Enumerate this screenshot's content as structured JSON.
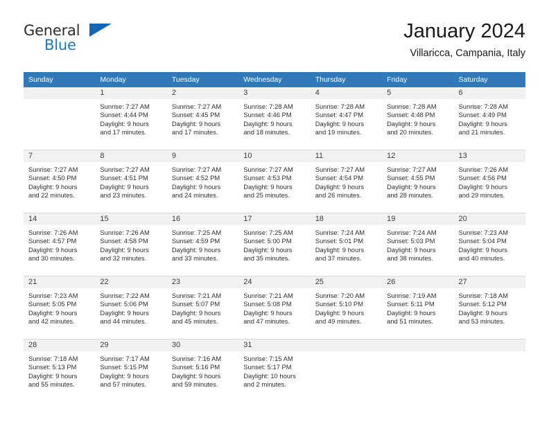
{
  "logo": {
    "word_top": "General",
    "word_bottom": "Blue",
    "triangle_color": "#1268b3",
    "blue_color": "#1a7ac4"
  },
  "header": {
    "title": "January 2024",
    "subtitle": "Villaricca, Campania, Italy"
  },
  "theme": {
    "header_row_bg": "#3179b9",
    "day_band_bg": "#f1f1f1",
    "grid_line": "#d9d9d9",
    "text": "#2e2e2e"
  },
  "weekday_headers": [
    "Sunday",
    "Monday",
    "Tuesday",
    "Wednesday",
    "Thursday",
    "Friday",
    "Saturday"
  ],
  "weeks": [
    [
      {
        "day": "",
        "sunrise": "",
        "sunset": "",
        "daylight1": "",
        "daylight2": ""
      },
      {
        "day": "1",
        "sunrise": "Sunrise: 7:27 AM",
        "sunset": "Sunset: 4:44 PM",
        "daylight1": "Daylight: 9 hours",
        "daylight2": "and 17 minutes."
      },
      {
        "day": "2",
        "sunrise": "Sunrise: 7:27 AM",
        "sunset": "Sunset: 4:45 PM",
        "daylight1": "Daylight: 9 hours",
        "daylight2": "and 17 minutes."
      },
      {
        "day": "3",
        "sunrise": "Sunrise: 7:28 AM",
        "sunset": "Sunset: 4:46 PM",
        "daylight1": "Daylight: 9 hours",
        "daylight2": "and 18 minutes."
      },
      {
        "day": "4",
        "sunrise": "Sunrise: 7:28 AM",
        "sunset": "Sunset: 4:47 PM",
        "daylight1": "Daylight: 9 hours",
        "daylight2": "and 19 minutes."
      },
      {
        "day": "5",
        "sunrise": "Sunrise: 7:28 AM",
        "sunset": "Sunset: 4:48 PM",
        "daylight1": "Daylight: 9 hours",
        "daylight2": "and 20 minutes."
      },
      {
        "day": "6",
        "sunrise": "Sunrise: 7:28 AM",
        "sunset": "Sunset: 4:49 PM",
        "daylight1": "Daylight: 9 hours",
        "daylight2": "and 21 minutes."
      }
    ],
    [
      {
        "day": "7",
        "sunrise": "Sunrise: 7:27 AM",
        "sunset": "Sunset: 4:50 PM",
        "daylight1": "Daylight: 9 hours",
        "daylight2": "and 22 minutes."
      },
      {
        "day": "8",
        "sunrise": "Sunrise: 7:27 AM",
        "sunset": "Sunset: 4:51 PM",
        "daylight1": "Daylight: 9 hours",
        "daylight2": "and 23 minutes."
      },
      {
        "day": "9",
        "sunrise": "Sunrise: 7:27 AM",
        "sunset": "Sunset: 4:52 PM",
        "daylight1": "Daylight: 9 hours",
        "daylight2": "and 24 minutes."
      },
      {
        "day": "10",
        "sunrise": "Sunrise: 7:27 AM",
        "sunset": "Sunset: 4:53 PM",
        "daylight1": "Daylight: 9 hours",
        "daylight2": "and 25 minutes."
      },
      {
        "day": "11",
        "sunrise": "Sunrise: 7:27 AM",
        "sunset": "Sunset: 4:54 PM",
        "daylight1": "Daylight: 9 hours",
        "daylight2": "and 26 minutes."
      },
      {
        "day": "12",
        "sunrise": "Sunrise: 7:27 AM",
        "sunset": "Sunset: 4:55 PM",
        "daylight1": "Daylight: 9 hours",
        "daylight2": "and 28 minutes."
      },
      {
        "day": "13",
        "sunrise": "Sunrise: 7:26 AM",
        "sunset": "Sunset: 4:56 PM",
        "daylight1": "Daylight: 9 hours",
        "daylight2": "and 29 minutes."
      }
    ],
    [
      {
        "day": "14",
        "sunrise": "Sunrise: 7:26 AM",
        "sunset": "Sunset: 4:57 PM",
        "daylight1": "Daylight: 9 hours",
        "daylight2": "and 30 minutes."
      },
      {
        "day": "15",
        "sunrise": "Sunrise: 7:26 AM",
        "sunset": "Sunset: 4:58 PM",
        "daylight1": "Daylight: 9 hours",
        "daylight2": "and 32 minutes."
      },
      {
        "day": "16",
        "sunrise": "Sunrise: 7:25 AM",
        "sunset": "Sunset: 4:59 PM",
        "daylight1": "Daylight: 9 hours",
        "daylight2": "and 33 minutes."
      },
      {
        "day": "17",
        "sunrise": "Sunrise: 7:25 AM",
        "sunset": "Sunset: 5:00 PM",
        "daylight1": "Daylight: 9 hours",
        "daylight2": "and 35 minutes."
      },
      {
        "day": "18",
        "sunrise": "Sunrise: 7:24 AM",
        "sunset": "Sunset: 5:01 PM",
        "daylight1": "Daylight: 9 hours",
        "daylight2": "and 37 minutes."
      },
      {
        "day": "19",
        "sunrise": "Sunrise: 7:24 AM",
        "sunset": "Sunset: 5:03 PM",
        "daylight1": "Daylight: 9 hours",
        "daylight2": "and 38 minutes."
      },
      {
        "day": "20",
        "sunrise": "Sunrise: 7:23 AM",
        "sunset": "Sunset: 5:04 PM",
        "daylight1": "Daylight: 9 hours",
        "daylight2": "and 40 minutes."
      }
    ],
    [
      {
        "day": "21",
        "sunrise": "Sunrise: 7:23 AM",
        "sunset": "Sunset: 5:05 PM",
        "daylight1": "Daylight: 9 hours",
        "daylight2": "and 42 minutes."
      },
      {
        "day": "22",
        "sunrise": "Sunrise: 7:22 AM",
        "sunset": "Sunset: 5:06 PM",
        "daylight1": "Daylight: 9 hours",
        "daylight2": "and 44 minutes."
      },
      {
        "day": "23",
        "sunrise": "Sunrise: 7:21 AM",
        "sunset": "Sunset: 5:07 PM",
        "daylight1": "Daylight: 9 hours",
        "daylight2": "and 45 minutes."
      },
      {
        "day": "24",
        "sunrise": "Sunrise: 7:21 AM",
        "sunset": "Sunset: 5:08 PM",
        "daylight1": "Daylight: 9 hours",
        "daylight2": "and 47 minutes."
      },
      {
        "day": "25",
        "sunrise": "Sunrise: 7:20 AM",
        "sunset": "Sunset: 5:10 PM",
        "daylight1": "Daylight: 9 hours",
        "daylight2": "and 49 minutes."
      },
      {
        "day": "26",
        "sunrise": "Sunrise: 7:19 AM",
        "sunset": "Sunset: 5:11 PM",
        "daylight1": "Daylight: 9 hours",
        "daylight2": "and 51 minutes."
      },
      {
        "day": "27",
        "sunrise": "Sunrise: 7:18 AM",
        "sunset": "Sunset: 5:12 PM",
        "daylight1": "Daylight: 9 hours",
        "daylight2": "and 53 minutes."
      }
    ],
    [
      {
        "day": "28",
        "sunrise": "Sunrise: 7:18 AM",
        "sunset": "Sunset: 5:13 PM",
        "daylight1": "Daylight: 9 hours",
        "daylight2": "and 55 minutes."
      },
      {
        "day": "29",
        "sunrise": "Sunrise: 7:17 AM",
        "sunset": "Sunset: 5:15 PM",
        "daylight1": "Daylight: 9 hours",
        "daylight2": "and 57 minutes."
      },
      {
        "day": "30",
        "sunrise": "Sunrise: 7:16 AM",
        "sunset": "Sunset: 5:16 PM",
        "daylight1": "Daylight: 9 hours",
        "daylight2": "and 59 minutes."
      },
      {
        "day": "31",
        "sunrise": "Sunrise: 7:15 AM",
        "sunset": "Sunset: 5:17 PM",
        "daylight1": "Daylight: 10 hours",
        "daylight2": "and 2 minutes."
      },
      {
        "day": "",
        "sunrise": "",
        "sunset": "",
        "daylight1": "",
        "daylight2": ""
      },
      {
        "day": "",
        "sunrise": "",
        "sunset": "",
        "daylight1": "",
        "daylight2": ""
      },
      {
        "day": "",
        "sunrise": "",
        "sunset": "",
        "daylight1": "",
        "daylight2": ""
      }
    ]
  ]
}
